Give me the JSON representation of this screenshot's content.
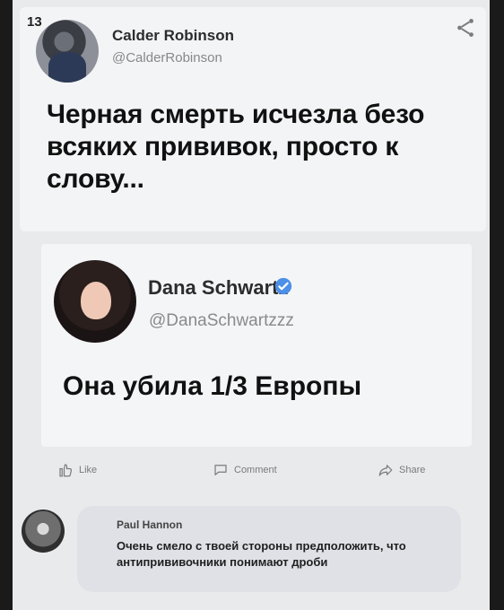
{
  "post": {
    "count": "13",
    "author_name": "Calder Robinson",
    "author_handle": "@CalderRobinson",
    "text": "Черная смерть исчезла безо всяких прививок, просто к слову..."
  },
  "quoted": {
    "author_name": "Dana Schwartz",
    "author_handle": "@DanaSchwartzzz",
    "text": "Она убила 1/3 Европы"
  },
  "actions": {
    "like": "Like",
    "comment": "Comment",
    "share": "Share"
  },
  "comment": {
    "author_name": "Paul Hannon",
    "text": "Очень смело с твоей стороны предположить, что антипрививочники понимают дроби"
  },
  "icons": {
    "share": "share-icon",
    "verified": "verified-icon",
    "like": "thumbs-up-icon",
    "comment": "comment-icon",
    "share_action": "share-arrow-icon"
  },
  "colors": {
    "verified": "#4c8fe8",
    "background": "#e9eaec"
  }
}
